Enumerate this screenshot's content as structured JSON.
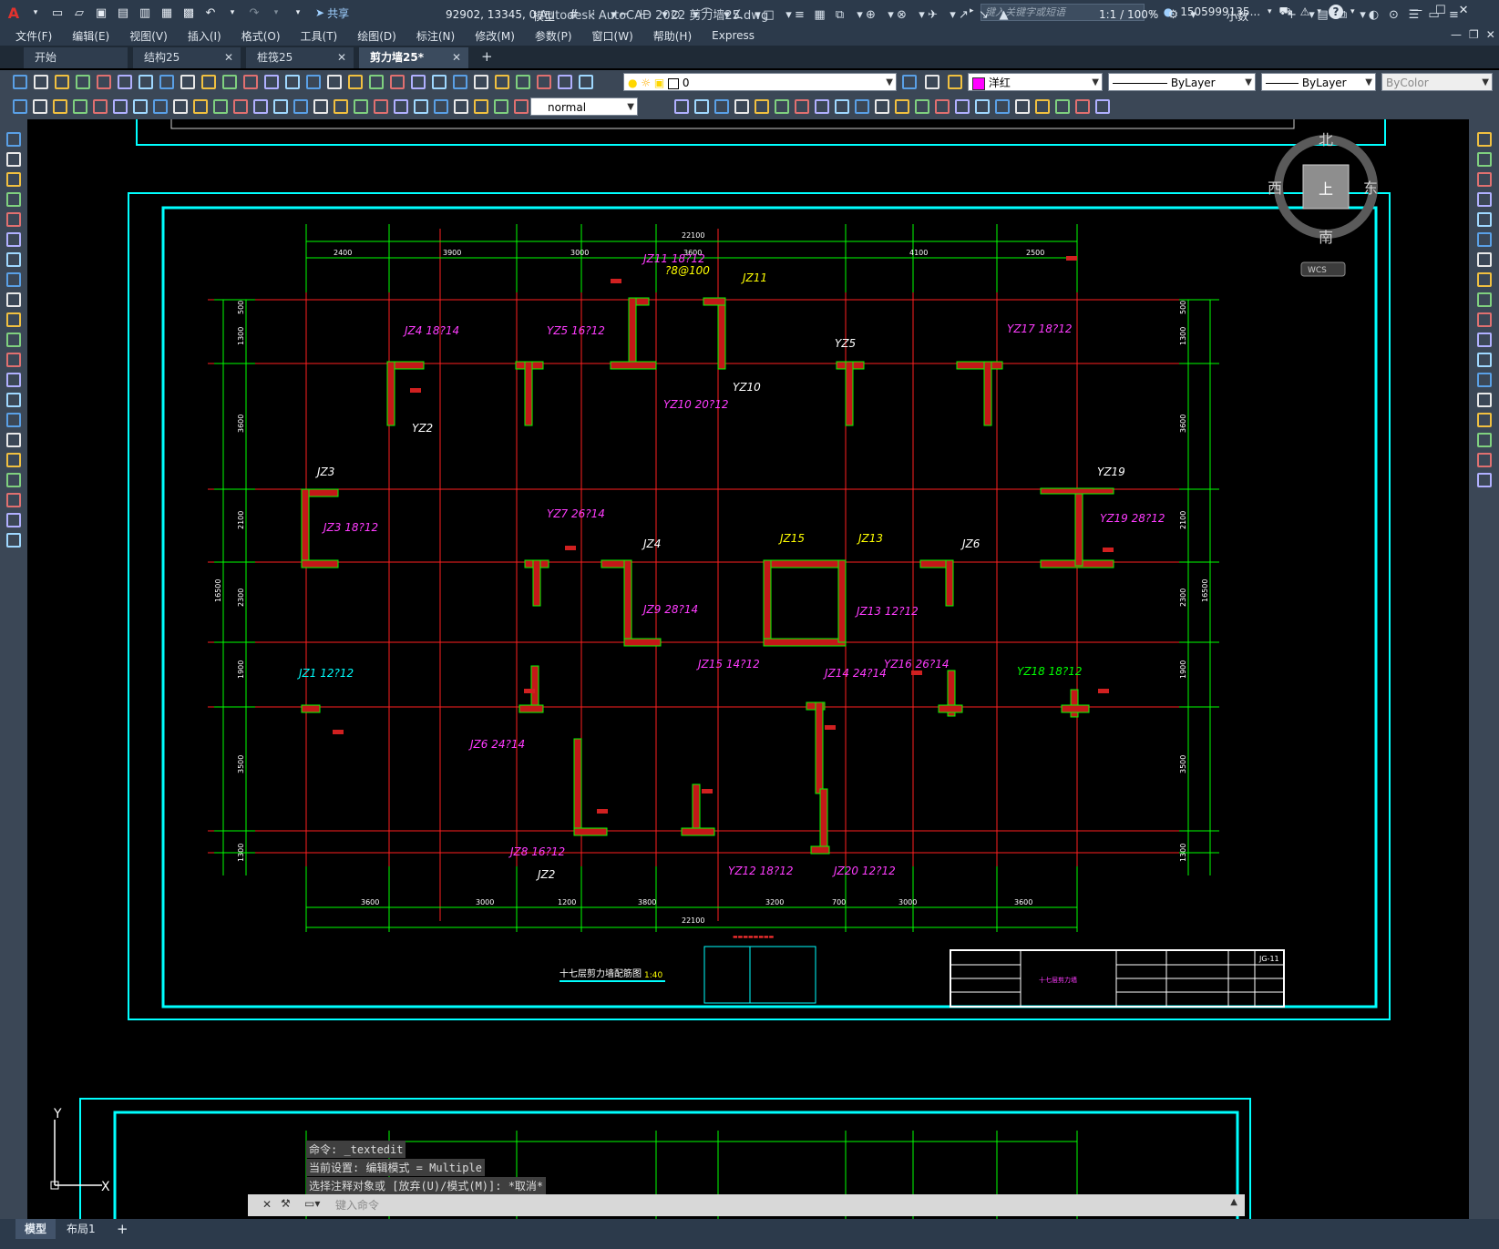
{
  "app": {
    "title": "Autodesk AutoCAD 2022    剪力墙25.dwg",
    "share_label": "共享",
    "search_placeholder": "键入关键字或短语",
    "user": "1505999135...",
    "help_icon": "?"
  },
  "menu": [
    "文件(F)",
    "编辑(E)",
    "视图(V)",
    "插入(I)",
    "格式(O)",
    "工具(T)",
    "绘图(D)",
    "标注(N)",
    "修改(M)",
    "参数(P)",
    "窗口(W)",
    "帮助(H)",
    "Express"
  ],
  "tabs": [
    {
      "label": "开始",
      "active": false
    },
    {
      "label": "结构25",
      "active": false
    },
    {
      "label": "桩筏25",
      "active": false
    },
    {
      "label": "剪力墙25*",
      "active": true
    }
  ],
  "toolbar": {
    "layer_value": "0",
    "color_value": "洋红",
    "linetype_value": "ByLayer",
    "lineweight_value": "ByLayer",
    "plotstyle_value": "ByColor",
    "textstyle_value": "normal"
  },
  "viewcube": {
    "north": "北",
    "south": "南",
    "east": "东",
    "west": "西",
    "top": "上",
    "wcs": "WCS"
  },
  "drawing": {
    "dims_top": [
      "2400",
      "3900",
      "3000",
      "3600",
      "4100",
      "2500"
    ],
    "total_top": "22100",
    "dims_bottom": [
      "3600",
      "3000",
      "1200",
      "3800",
      "3200",
      "700",
      "3000",
      "3600"
    ],
    "total_bottom": "22100",
    "dims_left": [
      "500",
      "1300",
      "3600",
      "2100",
      "2300",
      "1900",
      "3500",
      "1300"
    ],
    "total_side": "16500",
    "dims_right": [
      "500",
      "1300",
      "3600",
      "2100",
      "2300",
      "1900",
      "3500",
      "1300"
    ],
    "plan_title": "十七层剪力墙配筋图",
    "plan_scale": "1:40",
    "drawing_no": "JG-11",
    "table_text": "十七层剪力墙",
    "labels": [
      {
        "t": "JZ11  18?12",
        "c": "#ff3cff"
      },
      {
        "t": "?8@100",
        "c": "#ffff00"
      },
      {
        "t": "JZ11",
        "c": "#ffff00"
      },
      {
        "t": "JZ4  18?14",
        "c": "#ff3cff"
      },
      {
        "t": "YZ5  16?12",
        "c": "#ff3cff"
      },
      {
        "t": "YZ5",
        "c": "#ffffff"
      },
      {
        "t": "YZ17  18?12",
        "c": "#ff3cff"
      },
      {
        "t": "YZ10  20?12",
        "c": "#ff3cff"
      },
      {
        "t": "YZ10",
        "c": "#ffffff"
      },
      {
        "t": "YZ2",
        "c": "#ffffff"
      },
      {
        "t": "JZ3",
        "c": "#ffffff"
      },
      {
        "t": "JZ3  18?12",
        "c": "#ff3cff"
      },
      {
        "t": "YZ7  26?14",
        "c": "#ff3cff"
      },
      {
        "t": "JZ4",
        "c": "#ffffff"
      },
      {
        "t": "JZ15",
        "c": "#ffff00"
      },
      {
        "t": "JZ13",
        "c": "#ffff00"
      },
      {
        "t": "JZ6",
        "c": "#ffffff"
      },
      {
        "t": "YZ19",
        "c": "#ffffff"
      },
      {
        "t": "YZ19  28?12",
        "c": "#ff3cff"
      },
      {
        "t": "JZ9  28?14",
        "c": "#ff3cff"
      },
      {
        "t": "JZ13  12?12",
        "c": "#ff3cff"
      },
      {
        "t": "JZ15  14?12",
        "c": "#ff3cff"
      },
      {
        "t": "JZ14  24?14",
        "c": "#ff3cff"
      },
      {
        "t": "YZ16  26?14",
        "c": "#ff3cff"
      },
      {
        "t": "YZ18  18?12",
        "c": "#00ff00"
      },
      {
        "t": "JZ1  12?12",
        "c": "#00ffff"
      },
      {
        "t": "JZ6  24?14",
        "c": "#ff3cff"
      },
      {
        "t": "JZ8  16?12",
        "c": "#ff3cff"
      },
      {
        "t": "YZ12  18?12",
        "c": "#ff3cff"
      },
      {
        "t": "JZ20  12?12",
        "c": "#ff3cff"
      },
      {
        "t": "JZ2",
        "c": "#ffffff"
      }
    ]
  },
  "command": {
    "history": [
      "命令: _textedit",
      "当前设置: 编辑模式 = Multiple",
      "选择注释对象或 [放弃(U)/模式(M)]: *取消*"
    ],
    "placeholder": "键入命令"
  },
  "status": {
    "model_tab": "模型",
    "layout_tab": "布局1",
    "coords": "92902, 13345, 0",
    "space": "模型",
    "scale": "1:1 / 100%",
    "units": "小数"
  }
}
